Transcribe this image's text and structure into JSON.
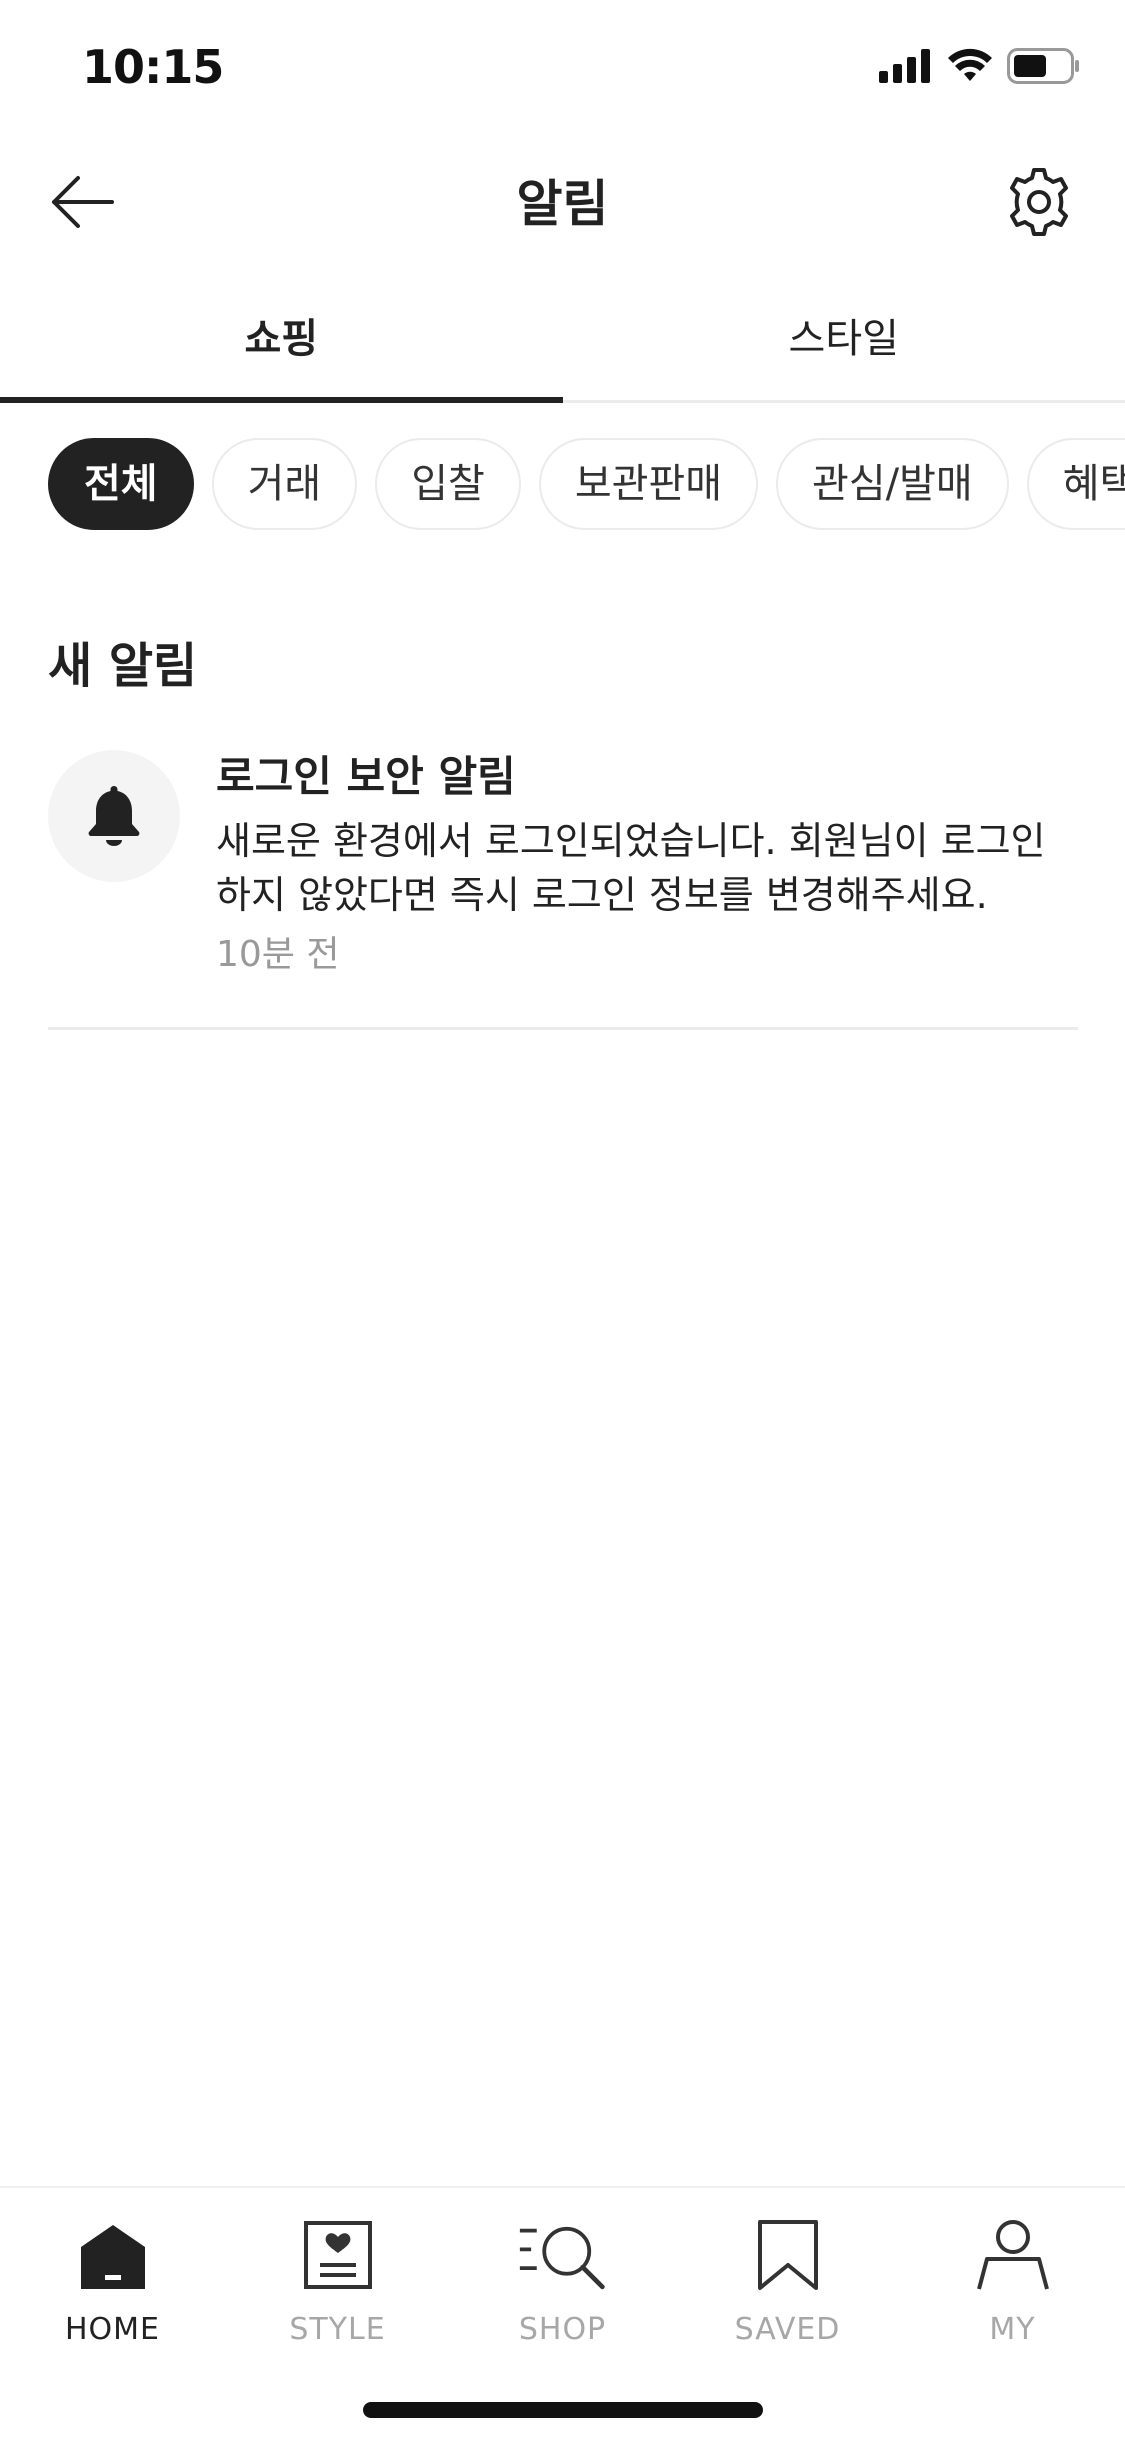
{
  "status_bar": {
    "time": "10:15"
  },
  "header": {
    "title": "알림"
  },
  "tabs": [
    {
      "label": "쇼핑",
      "active": true
    },
    {
      "label": "스타일",
      "active": false
    }
  ],
  "filters": [
    {
      "label": "전체",
      "active": true
    },
    {
      "label": "거래",
      "active": false
    },
    {
      "label": "입찰",
      "active": false
    },
    {
      "label": "보관판매",
      "active": false
    },
    {
      "label": "관심/발매",
      "active": false
    },
    {
      "label": "혜택",
      "active": false
    }
  ],
  "section": {
    "title": "새 알림"
  },
  "notifications": [
    {
      "icon": "bell-icon",
      "title": "로그인 보안 알림",
      "text": "새로운 환경에서 로그인되었습니다. 회원님이 로그인 하지 않았다면 즉시 로그인 정보를 변경해주세요.",
      "time": "10분 전"
    }
  ],
  "bottom_nav": [
    {
      "label": "HOME",
      "icon": "home-icon",
      "active": true
    },
    {
      "label": "STYLE",
      "icon": "style-icon",
      "active": false
    },
    {
      "label": "SHOP",
      "icon": "shop-icon",
      "active": false
    },
    {
      "label": "SAVED",
      "icon": "bookmark-icon",
      "active": false
    },
    {
      "label": "MY",
      "icon": "person-icon",
      "active": false
    }
  ],
  "colors": {
    "text": "#222222",
    "muted": "#999999",
    "nav_inactive": "#a7a7a7",
    "divider": "#ebebeb",
    "chip_active_bg": "#222222"
  }
}
